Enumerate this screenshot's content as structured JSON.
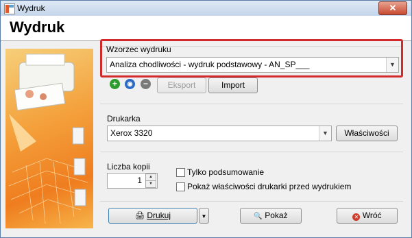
{
  "window": {
    "title": "Wydruk",
    "close_glyph": "✕"
  },
  "page_title": "Wydruk",
  "template": {
    "label": "Wzorzec wydruku",
    "value": "Analiza chodliwości - wydruk podstawowy - AN_SP___"
  },
  "template_toolbar": {
    "add_icon": "add-icon",
    "edit_icon": "magnifier-icon",
    "remove_icon": "remove-icon",
    "export_label": "Eksport",
    "import_label": "Import"
  },
  "printer": {
    "label": "Drukarka",
    "value": "Xerox 3320",
    "properties_button": "Właściwości"
  },
  "copies": {
    "label": "Liczba kopii",
    "value": "1"
  },
  "options": [
    {
      "label": "Tylko podsumowanie",
      "checked": false
    },
    {
      "label": "Pokaż właściwości drukarki przed wydrukiem",
      "checked": false
    }
  ],
  "actions": {
    "print_label": "Drukuj",
    "preview_label": "Pokaż",
    "back_label": "Wróć"
  },
  "colors": {
    "accent_red": "#d22a2a",
    "illustration_orange": "#ef7d1f"
  }
}
